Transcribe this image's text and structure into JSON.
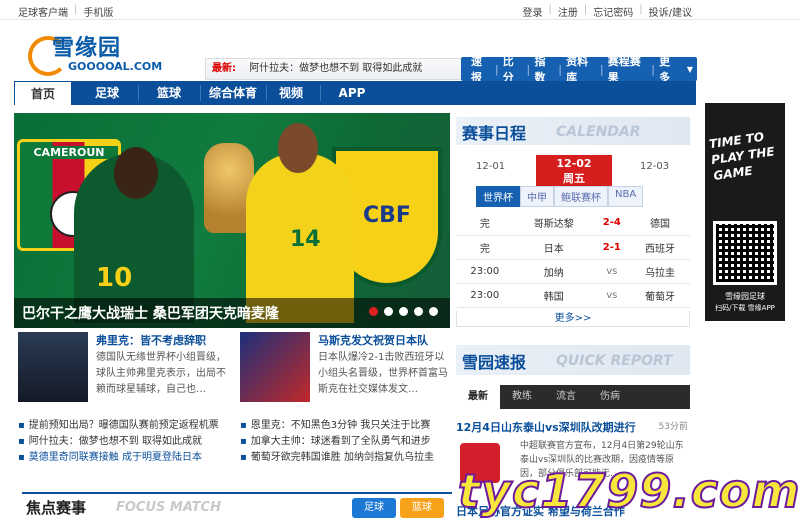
{
  "topbar": {
    "left": [
      "足球客户端",
      "手机版"
    ],
    "right": [
      "登录",
      "注册",
      "忘记密码",
      "投诉/建议"
    ]
  },
  "logo": {
    "name": "雪缘园",
    "domain": "GOOOOAL.COM"
  },
  "ticker": {
    "label": "最新:",
    "text": "阿什拉夫：做梦也想不到 取得如此成就"
  },
  "quicklinks": [
    "速报",
    "比分",
    "指数",
    "资料库",
    "赛程赛果",
    "更多"
  ],
  "nav": [
    "首页",
    "足球",
    "篮球",
    "综合体育",
    "视频",
    "APP"
  ],
  "hero": {
    "caption": "巴尔干之鹰大战瑞士 桑巴军团天克暗麦隆",
    "flag_text": "CAMEROUN",
    "badge_text": "CBF",
    "player1_number": "10",
    "player2_number": "14",
    "dots": 5,
    "active_dot": 0
  },
  "news": [
    {
      "title": "弗里克：皆不考虑辞职",
      "body": "德国队无缘世界杯小组晋级，球队主帅弗里克表示，出局不赖而球星辅球，自己也…"
    },
    {
      "title": "马斯克发文祝贺日本队",
      "body": "日本队爆冷2-1击败西班牙以小组头名晋级，世界杯首富马斯克在社交媒体发文…"
    }
  ],
  "list_left": [
    {
      "cat": "提前预知出局？",
      "text": "曝德国队赛前预定返程机票"
    },
    {
      "cat": "阿什拉夫：",
      "text": "做梦也想不到 取得如此成就"
    },
    {
      "cat": "莫德里奇同",
      "text": "联赛接触 成于明夏登陆日本"
    }
  ],
  "list_right": [
    {
      "cat": "恩里克：",
      "text": "不知黑色3分钟 我只关注于比赛"
    },
    {
      "cat": "加拿大主帅：",
      "text": "球迷看到了全队勇气和进步"
    },
    {
      "cat": "葡萄牙欲",
      "text": "完韩国谁胜 加纳剑指复仇乌拉圭"
    }
  ],
  "focus": {
    "zh": "焦点赛事",
    "en": "FOCUS MATCH",
    "btn1": "足球",
    "btn2": "篮球"
  },
  "calendar": {
    "zh": "赛事日程",
    "en": "CALENDAR",
    "prev": "12-01",
    "today_date": "12-02",
    "today_week": "周五",
    "next": "12-03",
    "tabs": [
      "世界杯",
      "中甲",
      "鲍联赛杯",
      "NBA"
    ],
    "matches": [
      {
        "t": "完",
        "home": "哥斯达黎",
        "score": "2-4",
        "away": "德国"
      },
      {
        "t": "完",
        "home": "日本",
        "score": "2-1",
        "away": "西班牙"
      },
      {
        "t": "23:00",
        "home": "加纳",
        "score": "vs",
        "away": "乌拉圭"
      },
      {
        "t": "23:00",
        "home": "韩国",
        "score": "vs",
        "away": "葡萄牙"
      }
    ],
    "more": "更多>>"
  },
  "quick_report": {
    "zh": "雪园速报",
    "en": "QUICK REPORT",
    "tabs": [
      "最新",
      "教练",
      "流言",
      "伤病"
    ],
    "headline": "12月4日山东泰山vs深圳队改期进行",
    "time": "53分前",
    "body": "中超联赛官方宣布，12月4日第29轮山东泰山vs深圳队的比赛改期，因疫情等原因，部分俱乐部可能无…",
    "headline2": "日本足协官方证实 希望与荷兰合作"
  },
  "ad": {
    "slogan": "TIME TO PLAY THE GAME",
    "caption1": "雪缘园足球",
    "caption2": "扫码/下载 雪缘APP"
  },
  "watermark": "tyc1799.com",
  "colors": {
    "brand": "#0b4f9a",
    "accent": "#d61e1e"
  }
}
